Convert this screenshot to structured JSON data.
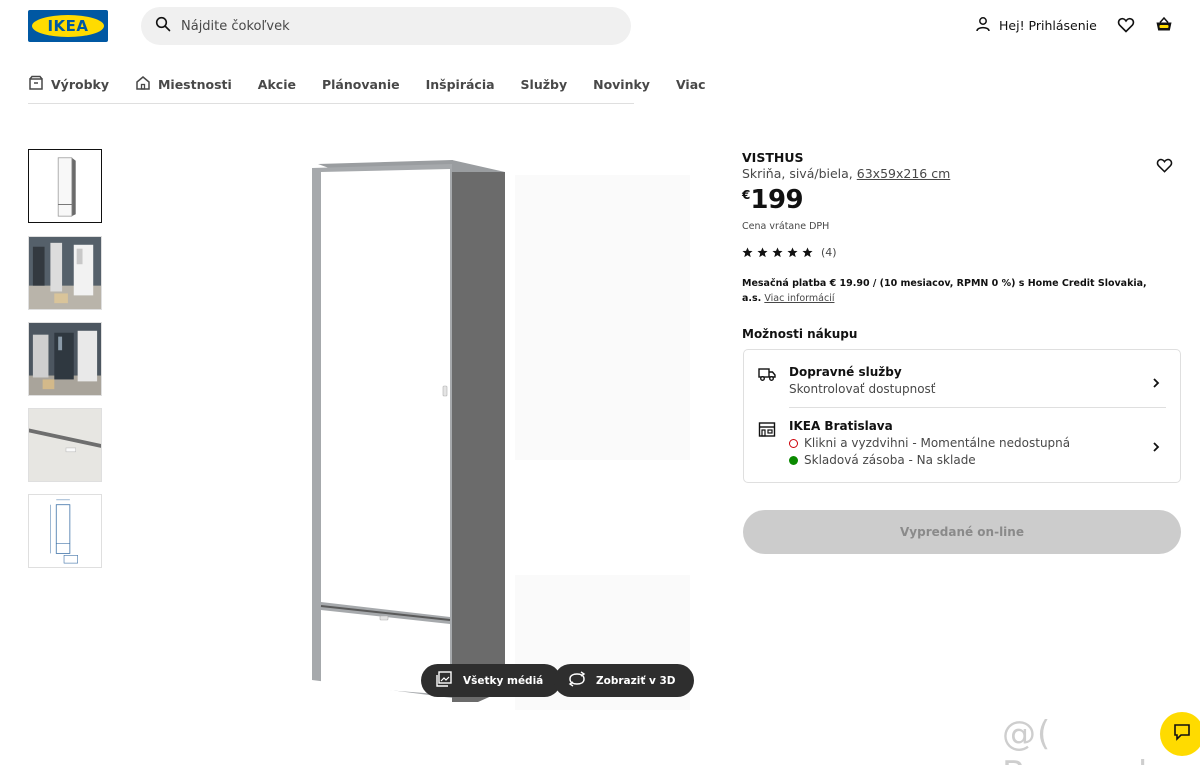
{
  "header": {
    "logo_text": "IKEA",
    "search_placeholder": "Nájdite čokoľvek",
    "login_label": "Hej! Prihlásenie",
    "brand_blue": "#0058a3",
    "brand_yellow": "#ffdb00"
  },
  "nav": {
    "items": [
      {
        "label": "Výrobky",
        "icon": "box-icon"
      },
      {
        "label": "Miestnosti",
        "icon": "house-icon"
      },
      {
        "label": "Akcie"
      },
      {
        "label": "Plánovanie"
      },
      {
        "label": "Inšpirácia"
      },
      {
        "label": "Služby"
      },
      {
        "label": "Novinky"
      },
      {
        "label": "Viac"
      }
    ]
  },
  "gallery": {
    "thumbnails": [
      "product-front",
      "room-scene-1",
      "room-scene-2",
      "detail-closeup",
      "dimension-drawing"
    ],
    "selected_index": 0,
    "all_media_label": "Všetky médiá",
    "view_3d_label": "Zobraziť v 3D"
  },
  "product": {
    "name": "VISTHUS",
    "description": "Skriňa, sivá/biela,",
    "dimensions": "63x59x216 cm",
    "currency": "€",
    "price": "199",
    "vat_note": "Cena vrátane DPH",
    "rating_stars": 5,
    "rating_count": "(4)",
    "monthly_bold": "Mesačná platba € 19.90 / (10 mesiacov, RPMN 0 %) s Home Credit Slovakia, a.s.",
    "monthly_link": "Viac informácií"
  },
  "purchase_options": {
    "title": "Možnosti nákupu",
    "delivery_title": "Dopravné služby",
    "delivery_sub": "Skontrolovať dostupnosť",
    "store_title": "IKEA Bratislava",
    "store_click_collect": "Klikni a vyzdvihni - Momentálne nedostupná",
    "store_stock": "Skladová zásoba - Na sklade",
    "status_unavailable_color": "#cc0008",
    "status_available_color": "#0a8a00"
  },
  "sold_out_label": "Vypredané on-line",
  "watermark": "@( Bazos.sk"
}
